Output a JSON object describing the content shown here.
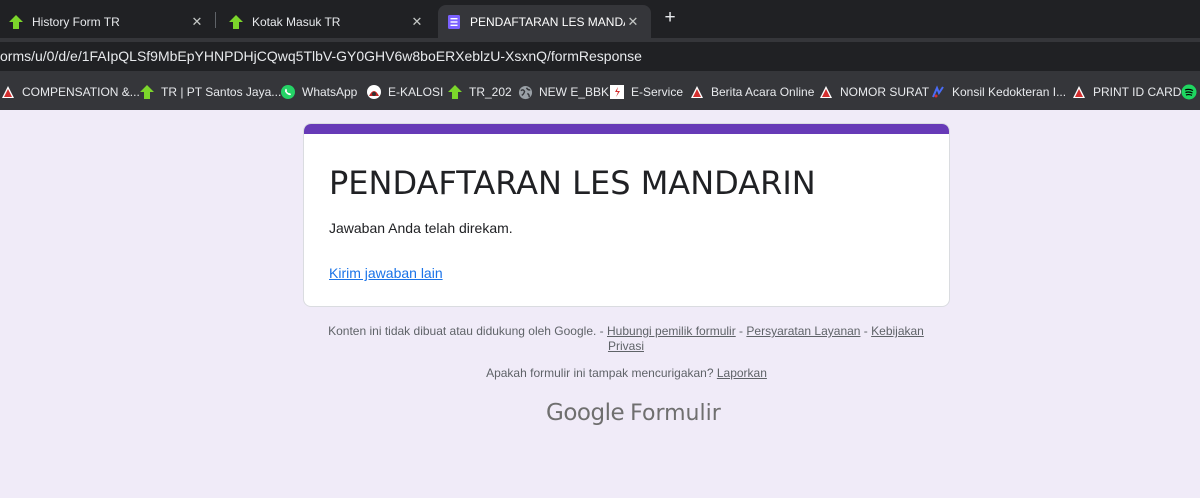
{
  "tabs": [
    {
      "label": "History Form TR",
      "icon": "green-up-arrow-icon",
      "active": false
    },
    {
      "label": "Kotak Masuk TR",
      "icon": "green-up-arrow-icon",
      "active": false
    },
    {
      "label": "PENDAFTARAN LES MANDARIN",
      "icon": "google-forms-icon",
      "active": true
    }
  ],
  "new_tab_label": "+",
  "tab_close_glyph": "✕",
  "address_bar": {
    "url": "orms/u/0/d/e/1FAIpQLSf9MbEpYHNPDHjCQwq5TlbV-GY0GHV6w8boERXeblzU-XsxnQ/formResponse"
  },
  "bookmarks": [
    {
      "label": "COMPENSATION &...",
      "icon": "red-triangle-icon"
    },
    {
      "label": "TR | PT Santos Jaya...",
      "icon": "green-up-arrow-icon"
    },
    {
      "label": "WhatsApp",
      "icon": "whatsapp-icon"
    },
    {
      "label": "E-KALOSI",
      "icon": "ekalosi-icon"
    },
    {
      "label": "TR_202",
      "icon": "green-up-arrow-icon"
    },
    {
      "label": "NEW E_BBK",
      "icon": "globe-icon"
    },
    {
      "label": "E-Service",
      "icon": "eservice-icon"
    },
    {
      "label": "Berita Acara Online",
      "icon": "red-triangle-icon"
    },
    {
      "label": "NOMOR SURAT",
      "icon": "red-triangle-icon"
    },
    {
      "label": "Konsil Kedokteran I...",
      "icon": "konsil-icon"
    },
    {
      "label": "PRINT ID CARD",
      "icon": "red-triangle-icon"
    },
    {
      "label": "",
      "icon": "spotify-icon"
    }
  ],
  "form": {
    "title": "PENDAFTARAN LES MANDARIN",
    "confirmation": "Jawaban Anda telah direkam.",
    "submit_another": "Kirim jawaban lain",
    "accent_color": "#673ab7"
  },
  "footer": {
    "disclaimer": "Konten ini tidak dibuat atau didukung oleh Google. - ",
    "contact_owner": "Hubungi pemilik formulir",
    "sep1": " - ",
    "terms": "Persyaratan Layanan",
    "sep2": " - ",
    "privacy": "Kebijakan Privasi",
    "suspicious": "Apakah formulir ini tampak mencurigakan? ",
    "report": "Laporkan"
  },
  "brand": {
    "google": "Google",
    "product": "Formulir"
  }
}
